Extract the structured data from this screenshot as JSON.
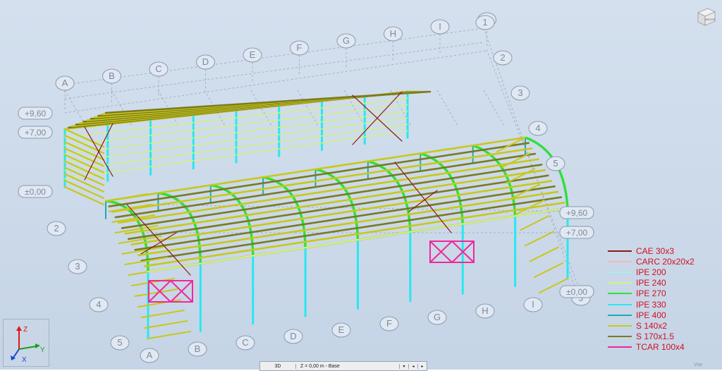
{
  "grid_axes": {
    "letters_back": [
      "A",
      "B",
      "C",
      "D",
      "E",
      "F",
      "G",
      "H",
      "I",
      "J"
    ],
    "numbers_back": [
      "1",
      "2",
      "3",
      "4",
      "5"
    ],
    "letters_front": [
      "A",
      "B",
      "C",
      "D",
      "E",
      "F",
      "G",
      "H",
      "I",
      "J"
    ],
    "numbers_front": [
      "2",
      "3",
      "4",
      "5"
    ]
  },
  "levels": {
    "back": [
      "+9,60",
      "+7,00",
      "±0,00"
    ],
    "right": [
      "+9,60",
      "+7,00",
      "±0,00"
    ]
  },
  "legend": [
    {
      "label": "CAE 30x3",
      "color": "#8b1a1a"
    },
    {
      "label": "CARC 20x20x2",
      "color": "#f2b8c0"
    },
    {
      "label": "IPE 200",
      "color": "#a8f0ec"
    },
    {
      "label": "IPE 240",
      "color": "#d4f27a"
    },
    {
      "label": "IPE 270",
      "color": "#2ee03a"
    },
    {
      "label": "IPE 330",
      "color": "#28e8f0"
    },
    {
      "label": "IPE 400",
      "color": "#22a8b0"
    },
    {
      "label": "S 140x2",
      "color": "#c8c818"
    },
    {
      "label": "S 170x1.5",
      "color": "#7a7a20"
    },
    {
      "label": "TCAR 100x4",
      "color": "#f0289a"
    }
  ],
  "view_cube": {
    "label": "DROITE"
  },
  "axis_widget": {
    "z": "Z",
    "y": "Y",
    "x": "X"
  },
  "status_bar": {
    "view": "3D",
    "level": "Z = 0,00 m - Base",
    "dropdown": "▾",
    "prev": "◂",
    "next": "▸"
  },
  "corner": {
    "label": "Vue"
  }
}
